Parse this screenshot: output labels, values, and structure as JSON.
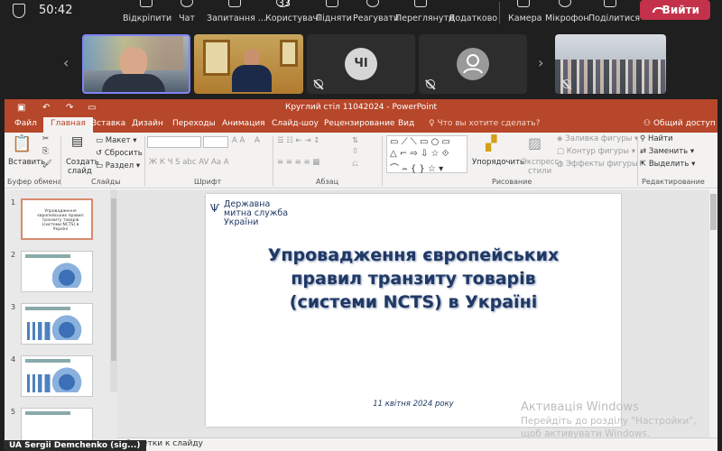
{
  "teams": {
    "clock": "50:42",
    "buttons": {
      "unpin": "Відкріпити",
      "chat": "Чат",
      "qa": "Запитання ...",
      "people": "Користувачі",
      "people_count": "33",
      "raise": "Підняти",
      "react": "Реагувати",
      "view": "Переглянути",
      "apps": "Додатково",
      "camera": "Камера",
      "mic": "Мікрофон",
      "share": "Поділитися",
      "leave": "Вийти"
    },
    "tiles": [
      {
        "type": "video"
      },
      {
        "type": "video"
      },
      {
        "initials": "ЧІ",
        "muted": true
      },
      {
        "type": "avatar",
        "muted": true
      },
      {
        "type": "video",
        "muted": true
      }
    ],
    "participant_name": "UA Sergii Demchenko (sig...)"
  },
  "ppt": {
    "window_title": "Круглий стіл 11042024 - PowerPoint",
    "menu": [
      "Файл",
      "Главная",
      "Вставка",
      "Дизайн",
      "Переходы",
      "Анимация",
      "Слайд-шоу",
      "Рецензирование",
      "Вид"
    ],
    "active_menu": "Главная",
    "tell_me": "Что вы хотите сделать?",
    "share": "Общий доступ",
    "ribbon": {
      "paste": "Вставить",
      "create_slide_1": "Создать",
      "create_slide_2": "слайд",
      "layout": "Макет",
      "reset": "Сбросить",
      "section": "Раздел",
      "font_btns": "Ж  К  Ч  S  abc  AV  Аа  A",
      "arrange": "Упорядочить",
      "express_1": "Экспресс-",
      "express_2": "стили",
      "fill": "Заливка фигуры",
      "outline": "Контур фигуры",
      "effects": "Эффекты фигуры",
      "find": "Найти",
      "replace": "Заменить",
      "select": "Выделить",
      "groups": {
        "clipboard": "Буфер обмена",
        "slides": "Слайды",
        "font": "Шрифт",
        "paragraph": "Абзац",
        "drawing": "Рисование",
        "editing": "Редактирование"
      }
    },
    "thumbnails": [
      "1",
      "2",
      "3",
      "4",
      "5"
    ],
    "thumb1_text": "Упровадження європейських правил транзиту товарів (системи NCTS) в Україні",
    "slide": {
      "org_line1": "Державна",
      "org_line2": "митна служба",
      "org_line3": "України",
      "title_line1": "Упровадження європейських",
      "title_line2": "правил транзиту товарів",
      "title_line3": "(системи NCTS) в Україні",
      "date": "11 квітня 2024 року"
    },
    "notes": "Заметки к слайду"
  },
  "windows_activation": {
    "line1": "Активація Windows",
    "line2": "Перейдіть до розділу \"Настройки\",",
    "line3": "щоб активувати Windows."
  }
}
